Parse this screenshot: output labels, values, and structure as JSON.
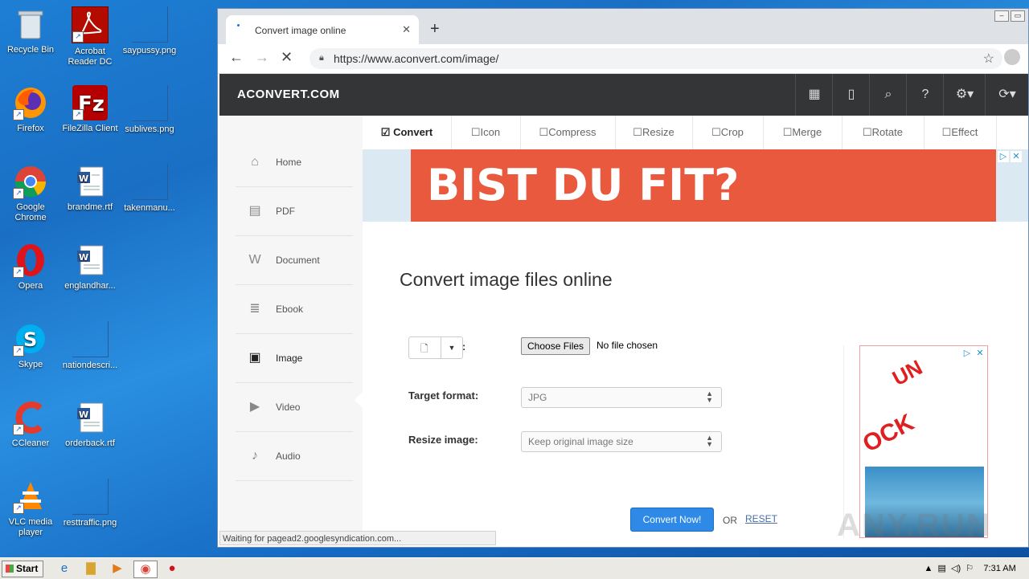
{
  "desktop": {
    "icons": [
      {
        "label": "Recycle Bin"
      },
      {
        "label": "Acrobat Reader DC"
      },
      {
        "label": "saypussy.png"
      },
      {
        "label": "Firefox"
      },
      {
        "label": "FileZilla Client"
      },
      {
        "label": "sublives.png"
      },
      {
        "label": "Google Chrome"
      },
      {
        "label": "brandme.rtf"
      },
      {
        "label": "takenmanu..."
      },
      {
        "label": "Opera"
      },
      {
        "label": "englandhar..."
      },
      {
        "label": "Skype"
      },
      {
        "label": "nationdescri..."
      },
      {
        "label": "CCleaner"
      },
      {
        "label": "orderback.rtf"
      },
      {
        "label": "VLC media player"
      },
      {
        "label": "resttraffic.png"
      }
    ]
  },
  "browser": {
    "tab_title": "Convert image files online",
    "tab_title_display": "Convert image online",
    "url": "https://www.aconvert.com/image/",
    "status": "Waiting for pagead2.googlesyndication.com..."
  },
  "site": {
    "logo": "ACONVERT.COM",
    "sidebar": [
      {
        "label": "Home",
        "icon": "home-icon",
        "glyph": "⌂"
      },
      {
        "label": "PDF",
        "icon": "pdf-icon",
        "glyph": "▤"
      },
      {
        "label": "Document",
        "icon": "document-icon",
        "glyph": "W"
      },
      {
        "label": "Ebook",
        "icon": "ebook-icon",
        "glyph": "≣"
      },
      {
        "label": "Image",
        "icon": "image-icon",
        "glyph": "▣"
      },
      {
        "label": "Video",
        "icon": "video-icon",
        "glyph": "▶"
      },
      {
        "label": "Audio",
        "icon": "audio-icon",
        "glyph": "♪"
      }
    ],
    "subnav": [
      {
        "label": "Convert",
        "check": "☑"
      },
      {
        "label": "Icon",
        "check": "☐"
      },
      {
        "label": "Compress",
        "check": "☐"
      },
      {
        "label": "Resize",
        "check": "☐"
      },
      {
        "label": "Crop",
        "check": "☐"
      },
      {
        "label": "Merge",
        "check": "☐"
      },
      {
        "label": "Rotate",
        "check": "☐"
      },
      {
        "label": "Effect",
        "check": "☐"
      }
    ],
    "ad_text": "BIST DU FIT?",
    "heading": "Convert image files online",
    "choose_files": "Choose Files",
    "no_file": "No file chosen",
    "target_format_label": "Target format:",
    "target_format_value": "JPG",
    "resize_label": "Resize image:",
    "resize_value": "Keep original image size",
    "convert_button": "Convert Now!",
    "or_text": "OR",
    "reset": "RESET",
    "side_ad_text1": "UN",
    "side_ad_text2": "OCK",
    "watermark": "ANY.RUN"
  },
  "taskbar": {
    "start": "Start",
    "time": "7:31 AM"
  }
}
